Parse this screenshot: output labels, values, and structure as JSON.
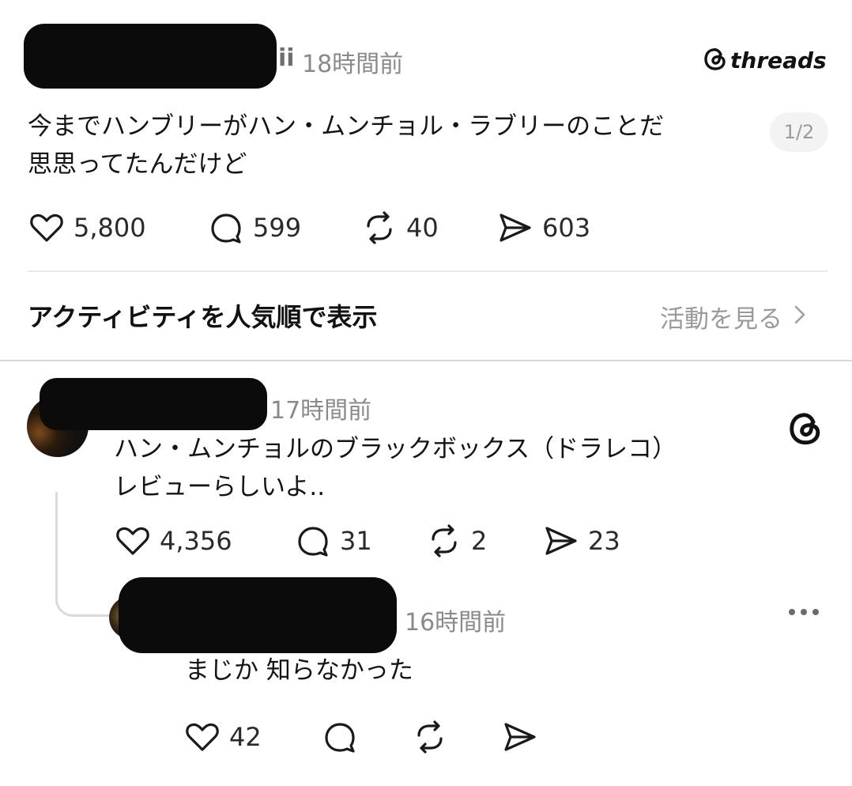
{
  "post": {
    "username_suffix": "ii",
    "timestamp": "18時間前",
    "text_line1": "今までハンブリーがハン・ムンチョル・ラブリーのことだ",
    "text_line2": "思思ってたんだけど",
    "page_indicator": "1/2",
    "likes": "5,800",
    "replies": "599",
    "reposts": "40",
    "shares": "603"
  },
  "brand": {
    "name": "threads"
  },
  "activity": {
    "title": "アクティビティを人気順で表示",
    "link_label": "活動を見る"
  },
  "reply1": {
    "timestamp": "17時間前",
    "text_line1": "ハン・ムンチョルのブラックボックス（ドラレコ）",
    "text_line2": "レビューらしいよ..",
    "likes": "4,356",
    "replies": "31",
    "reposts": "2",
    "shares": "23"
  },
  "reply2": {
    "timestamp": "16時間前",
    "text": "まじか 知らなかった",
    "likes": "42"
  },
  "icons": {
    "like": "heart-icon",
    "reply": "comment-icon",
    "repost": "repost-icon",
    "share": "send-icon",
    "more": "more-icon",
    "chevron": "chevron-right-icon",
    "logo": "threads-logo-icon"
  }
}
